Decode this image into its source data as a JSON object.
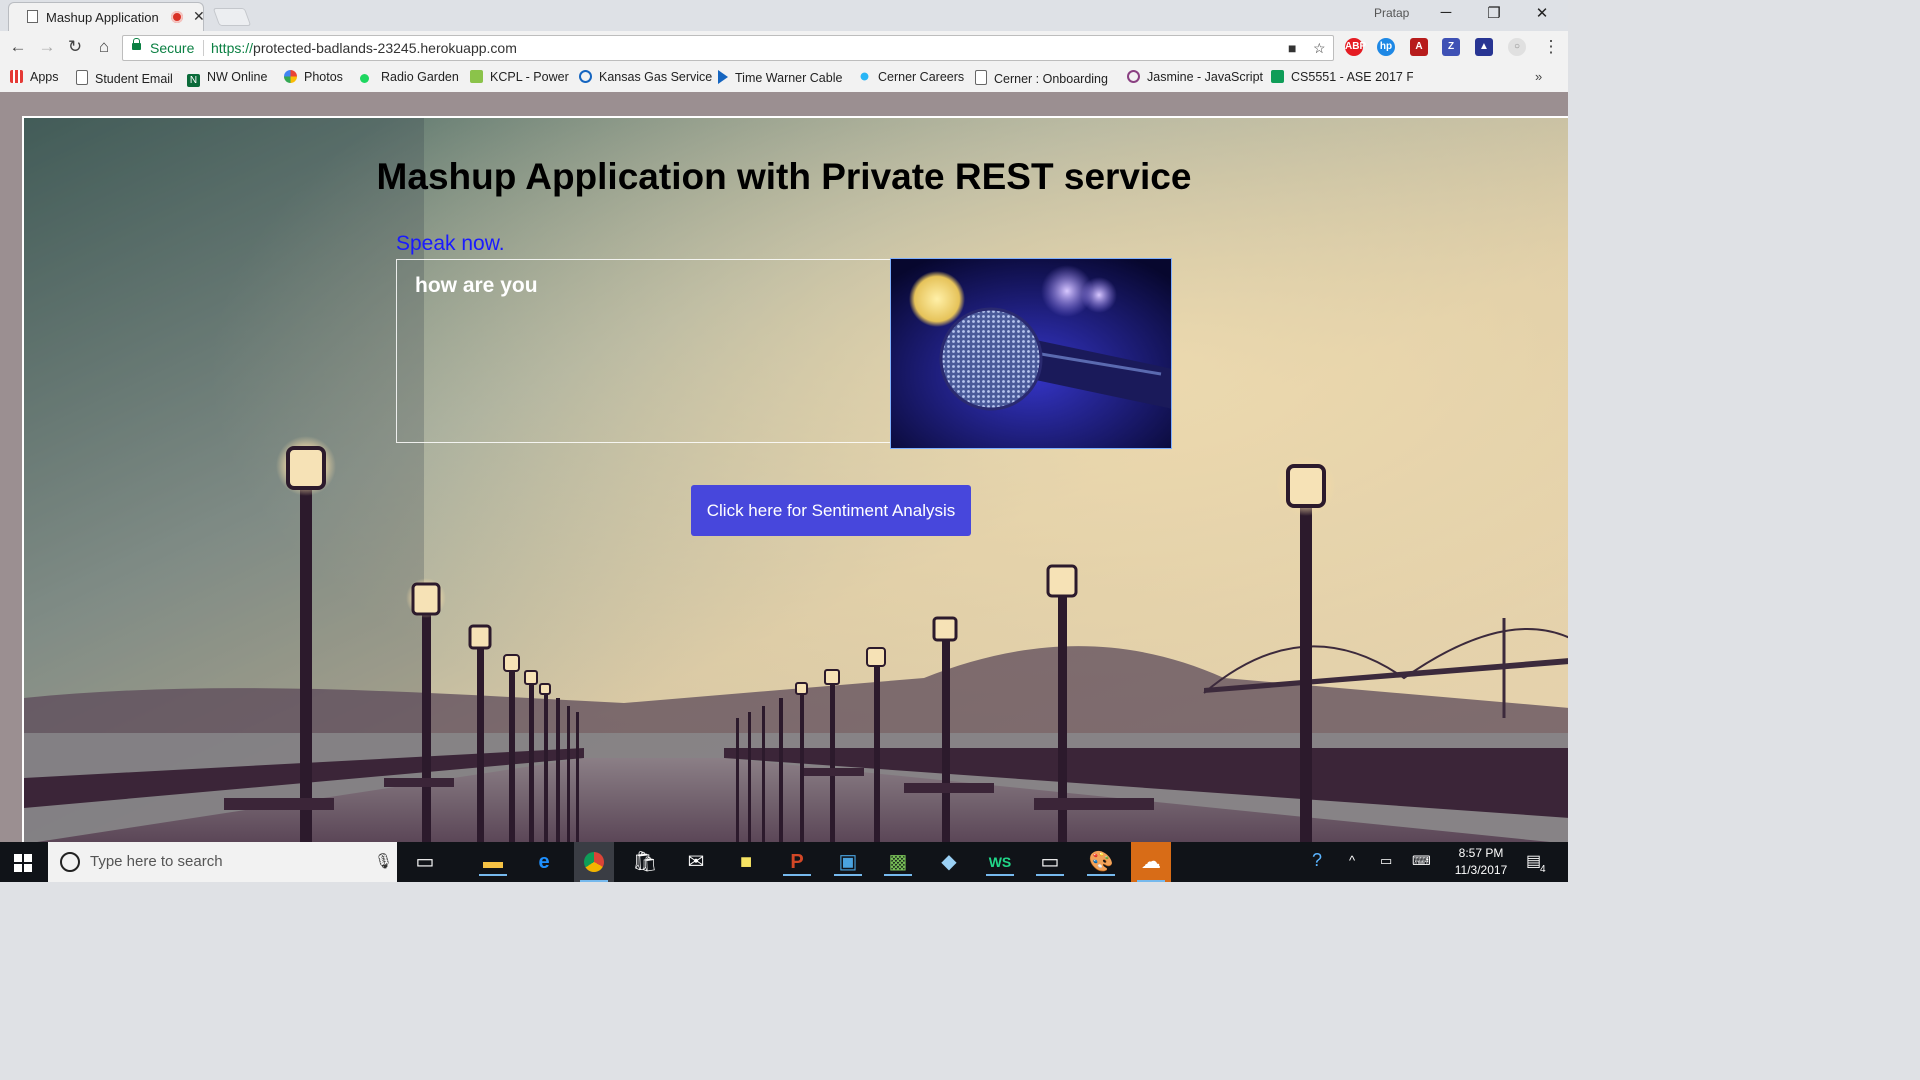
{
  "browser": {
    "tab_title": "Mashup Application",
    "profile_name": "Pratap",
    "secure_label": "Secure",
    "url_scheme": "https://",
    "url_host": "protected-badlands-23245.herokuapp.com"
  },
  "bookmarks": [
    {
      "label": "Apps",
      "icon": "apps-grid-icon"
    },
    {
      "label": "Student Email",
      "icon": "page-icon"
    },
    {
      "label": "NW Online",
      "icon": "nw-logo-icon"
    },
    {
      "label": "Photos",
      "icon": "photos-pinwheel-icon"
    },
    {
      "label": "Radio Garden",
      "icon": "green-dot-icon"
    },
    {
      "label": "KCPL - Power",
      "icon": "kcpl-logo-icon"
    },
    {
      "label": "Kansas Gas Service",
      "icon": "gas-logo-icon"
    },
    {
      "label": "Time Warner Cable",
      "icon": "play-arrow-icon"
    },
    {
      "label": "Cerner Careers",
      "icon": "cerner-logo-icon"
    },
    {
      "label": "Cerner : Onboarding",
      "icon": "page-icon"
    },
    {
      "label": "Jasmine - JavaScript",
      "icon": "jasmine-logo-icon"
    },
    {
      "label": "CS5551 - ASE 2017 F",
      "icon": "sheets-icon"
    }
  ],
  "page": {
    "heading": "Mashup Application with Private REST service",
    "speak_prompt": "Speak now.",
    "speech_text": "how are you",
    "sentiment_button": "Click here for Sentiment Analysis"
  },
  "taskbar": {
    "search_placeholder": "Type here to search",
    "time": "8:57 PM",
    "date": "11/3/2017",
    "notification_count": "4"
  },
  "colors": {
    "button_bg": "#4747dc",
    "speak_prompt": "#1a1aff",
    "secure_green": "#0b8043"
  }
}
